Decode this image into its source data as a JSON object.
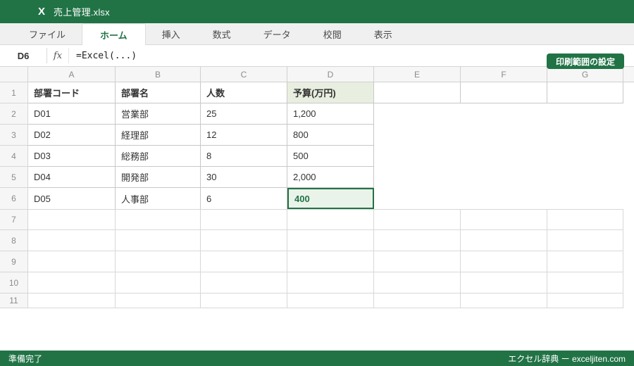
{
  "window": {
    "logo_letter": "X",
    "title": "売上管理.xlsx"
  },
  "menu": {
    "items": [
      {
        "label": "ファイル",
        "active": false
      },
      {
        "label": "ホーム",
        "active": true
      },
      {
        "label": "挿入",
        "active": false
      },
      {
        "label": "数式",
        "active": false
      },
      {
        "label": "データ",
        "active": false
      },
      {
        "label": "校閲",
        "active": false
      },
      {
        "label": "表示",
        "active": false
      }
    ]
  },
  "formula_bar": {
    "cell_ref": "D6",
    "fx_label": "fx",
    "formula": "=Excel(...)"
  },
  "print_button": {
    "label": "印刷範囲の設定"
  },
  "sheet": {
    "column_letters": [
      "A",
      "B",
      "C",
      "D",
      "E",
      "F",
      "G"
    ],
    "row_numbers": [
      "1",
      "2",
      "3",
      "4",
      "5",
      "6",
      "7",
      "8",
      "9",
      "10",
      "11"
    ],
    "header_row": [
      "部署コード",
      "部署名",
      "人数",
      "予算(万円)"
    ],
    "data_rows": [
      [
        "D01",
        "営業部",
        "25",
        "1,200"
      ],
      [
        "D02",
        "経理部",
        "12",
        "800"
      ],
      [
        "D03",
        "総務部",
        "8",
        "500"
      ],
      [
        "D04",
        "開発部",
        "30",
        "2,000"
      ],
      [
        "D05",
        "人事部",
        "6"
      ]
    ],
    "selected_cell": {
      "ref": "D6",
      "value": "400"
    }
  },
  "status_bar": {
    "left_text": "準備完了",
    "right_text": "エクセル辞典 ー exceljiten.com"
  },
  "colors": {
    "accent_green": "#217346",
    "selected_cell_fill": "#eaf3e9",
    "highlight_header_fill": "#e8efe0",
    "panel_gray": "#f0f0f0"
  }
}
